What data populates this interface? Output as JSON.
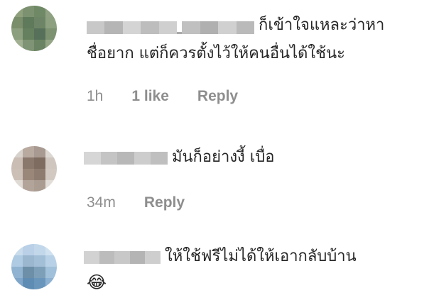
{
  "comments": [
    {
      "text_line1": "ก็เข้าใจแหละว่าหา",
      "text_line2": "ชื่อยาก แต่ก็ควรตั้งไว้ให้คนอื่นได้ใช้นะ",
      "time": "1h",
      "likes": "1 like",
      "reply": "Reply"
    },
    {
      "text_line1": "มันก็อย่างงี้ เบื่อ",
      "time": "34m",
      "reply": "Reply"
    },
    {
      "text_line1": "ให้ใช้ฟรีไม่ได้ให้เอากลับบ้าน",
      "emoji": "😂"
    }
  ],
  "colors": {
    "meta_text": "#8e8e8e",
    "comment_text": "#262626"
  },
  "icons": {
    "avatar_1": "blurred-avatar",
    "avatar_2": "blurred-avatar",
    "avatar_3": "blurred-avatar",
    "emoji": "face-with-tears-of-joy"
  }
}
